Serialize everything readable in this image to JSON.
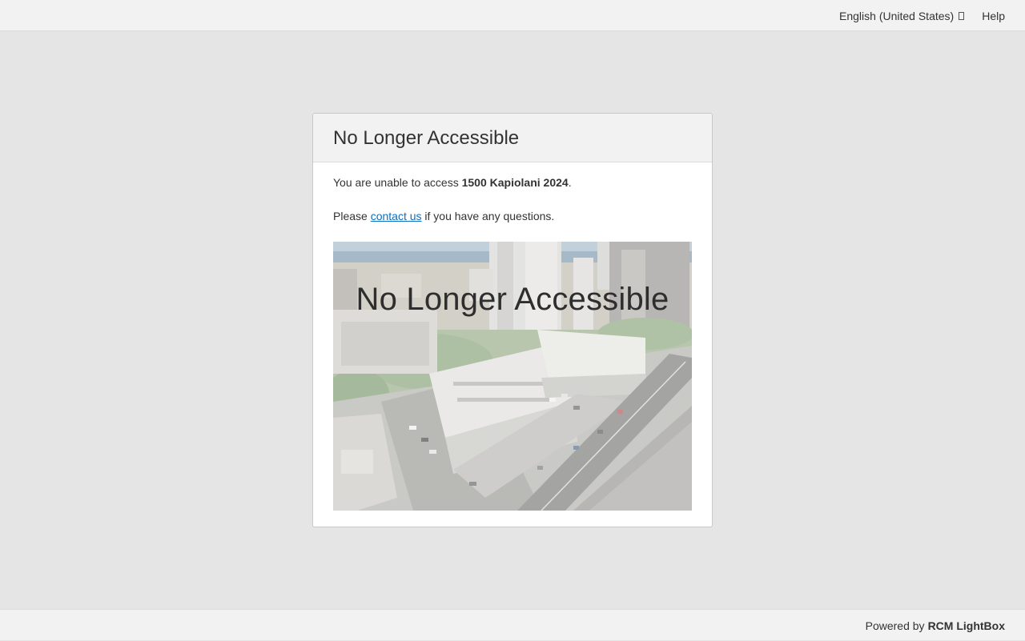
{
  "topbar": {
    "language": "English (United States)",
    "help": "Help"
  },
  "panel": {
    "title": "No Longer Accessible",
    "message_prefix": "You are unable to access ",
    "property_name": "1500 Kapiolani 2024",
    "message_suffix": ".",
    "contact_prefix": "Please ",
    "contact_link": "contact us",
    "contact_suffix": " if you have any questions.",
    "image_caption": "No Longer Accessible"
  },
  "footer": {
    "powered_by": "Powered by",
    "brand": "RCM LightBox"
  },
  "colors": {
    "background": "#e5e5e5",
    "bar": "#f2f2f2",
    "link": "#0a6fc2"
  }
}
